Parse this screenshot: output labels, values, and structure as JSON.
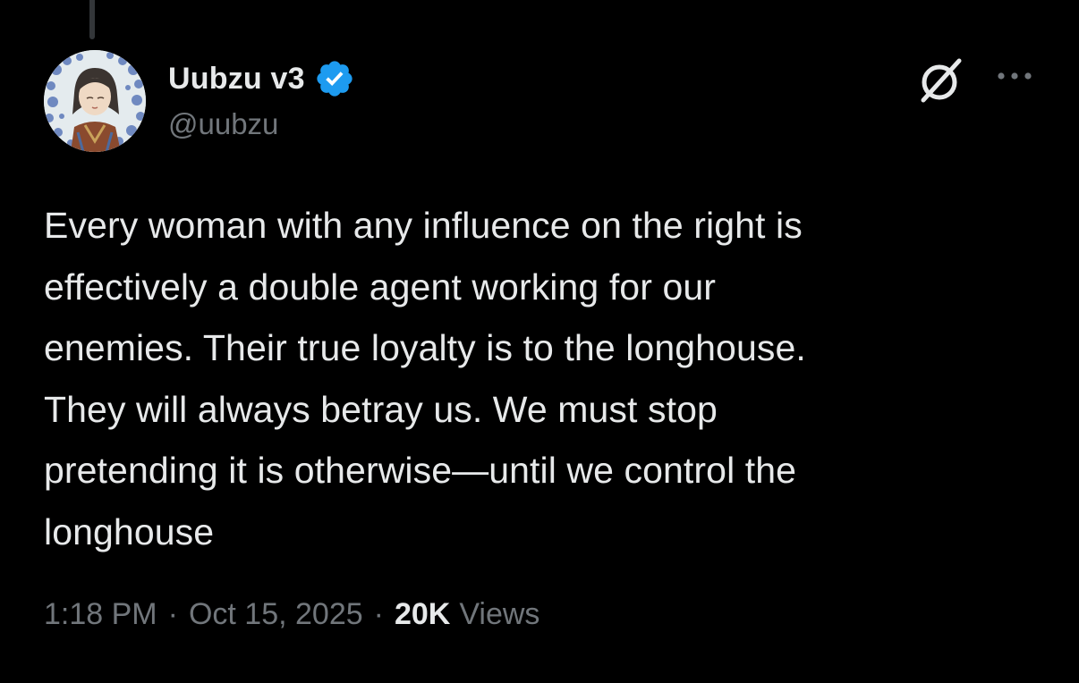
{
  "author": {
    "display_name": "Uubzu v3",
    "handle": "@uubzu",
    "verified": true
  },
  "icons": {
    "verified": "verified-badge-icon",
    "grok": "grok-icon",
    "more": "more-options-icon"
  },
  "post": {
    "text": "Every woman with any influence on the right is\neffectively a double agent working for our\nenemies. Their true loyalty is to the longhouse.\nThey will always betray us. We must stop\npretending it is otherwise—until we control the\nlonghouse",
    "time": "1:18 PM",
    "separator": "·",
    "date": "Oct 15, 2025",
    "views_count": "20K",
    "views_label": "Views"
  },
  "colors": {
    "background": "#000000",
    "primary_text": "#e7e9ea",
    "secondary_text": "#71767b",
    "verified_blue": "#1d9bf0"
  }
}
